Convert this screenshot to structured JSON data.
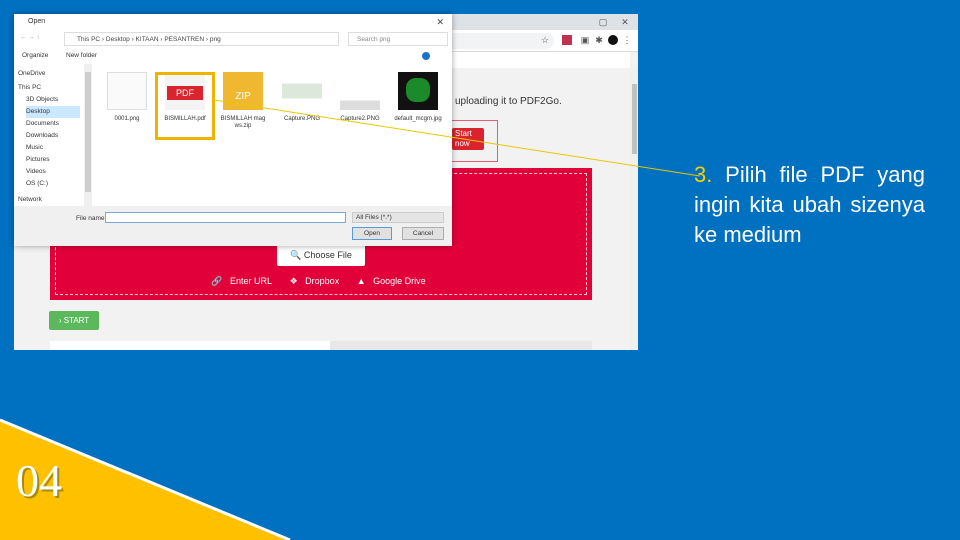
{
  "slide": {
    "number": "04",
    "step": "3.",
    "instruction": "Pilih file PDF yang ingin kita ubah sizenya ke medium",
    "colors": {
      "background": "#0070c0",
      "accent": "#ffc000",
      "highlight": "#f0b400"
    }
  },
  "browser": {
    "page_text": "uploading it to PDF2Go.",
    "start_now": "Start now",
    "choose_file": "Choose File",
    "links": [
      "Enter URL",
      "Dropbox",
      "Google Drive"
    ],
    "start_button": "START",
    "dropzone_color": "#e2003a"
  },
  "dialog": {
    "title": "Open",
    "path": [
      "This PC",
      "Desktop",
      "KITAAN",
      "PESANTREN",
      "png"
    ],
    "search_placeholder": "Search png",
    "organize": "Organize",
    "new_folder": "New folder",
    "nav": [
      "OneDrive",
      "This PC",
      "3D Objects",
      "Desktop",
      "Documents",
      "Downloads",
      "Music",
      "Pictures",
      "Videos",
      "OS (C:)",
      "Network"
    ],
    "files": [
      {
        "name": "0001.png",
        "icon": "image"
      },
      {
        "name": "BISMILLAH.pdf",
        "icon": "pdf"
      },
      {
        "name": "BISMILLAH mag ws.zip",
        "icon": "zip"
      },
      {
        "name": "Capture.PNG",
        "icon": "image"
      },
      {
        "name": "Capture2.PNG",
        "icon": "image"
      },
      {
        "name": "default_mcgm.jpg",
        "icon": "logo"
      }
    ],
    "selected_file": "BISMILLAH.pdf",
    "file_name_label": "File name:",
    "file_name_value": "",
    "file_type": "All Files (*.*)",
    "open": "Open",
    "cancel": "Cancel"
  }
}
